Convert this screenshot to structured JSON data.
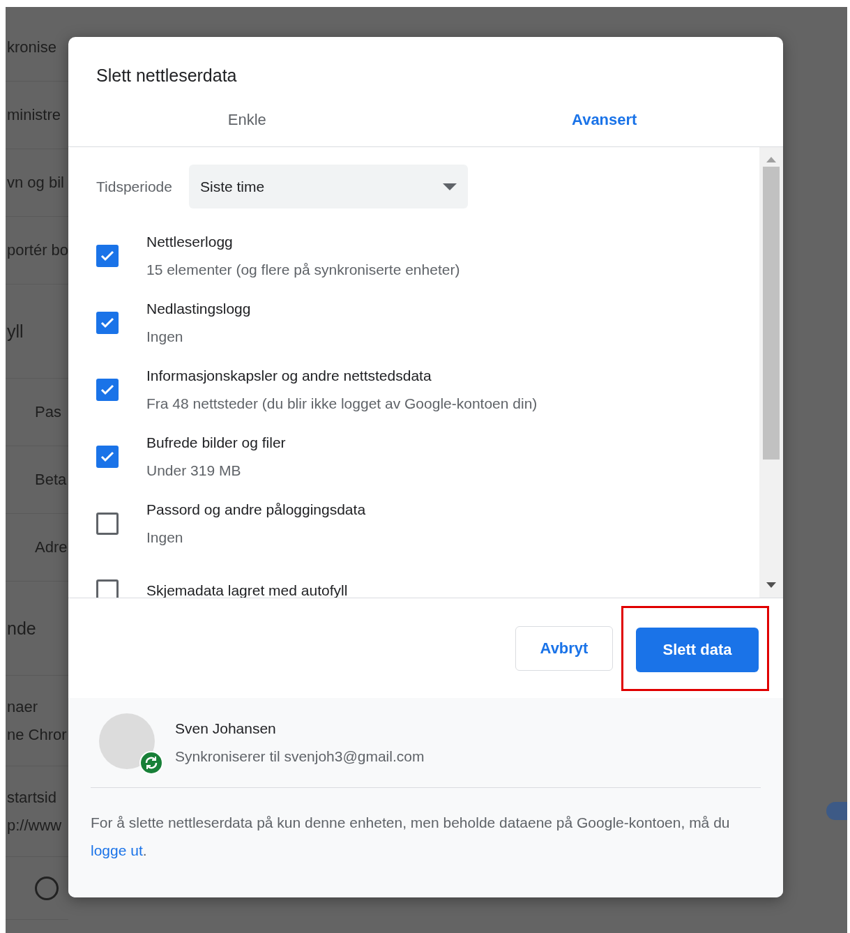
{
  "background": {
    "left_rows": [
      {
        "kind": "item",
        "lines": [
          "kronise"
        ]
      },
      {
        "kind": "item",
        "lines": [
          "ministre"
        ]
      },
      {
        "kind": "item",
        "lines": [
          "vn og bil"
        ]
      },
      {
        "kind": "item",
        "lines": [
          "portér bo"
        ]
      },
      {
        "kind": "heading",
        "lines": [
          "yll"
        ]
      },
      {
        "kind": "subitem",
        "lines": [
          "Pas"
        ]
      },
      {
        "kind": "subitem",
        "lines": [
          "Beta"
        ]
      },
      {
        "kind": "subitem",
        "lines": [
          "Adre"
        ]
      },
      {
        "kind": "heading",
        "lines": [
          "nde"
        ]
      },
      {
        "kind": "double",
        "lines": [
          "naer",
          "ne Chror"
        ]
      },
      {
        "kind": "double",
        "lines": [
          "startsid",
          "p://www"
        ]
      },
      {
        "kind": "radio",
        "selected": false
      }
    ],
    "toggle": {
      "on": true
    }
  },
  "dialog": {
    "title": "Slett nettleserdata",
    "tabs": [
      {
        "label": "Enkle",
        "selected": false
      },
      {
        "label": "Avansert",
        "selected": true
      }
    ],
    "time_range": {
      "label": "Tidsperiode",
      "value": "Siste time"
    },
    "options": [
      {
        "label": "Nettleserlogg",
        "detail": "15 elementer (og flere på synkroniserte enheter)",
        "checked": true
      },
      {
        "label": "Nedlastingslogg",
        "detail": "Ingen",
        "checked": true
      },
      {
        "label": "Informasjonskapsler og andre nettstedsdata",
        "detail": "Fra 48 nettsteder (du blir ikke logget av Google-kontoen din)",
        "checked": true
      },
      {
        "label": "Bufrede bilder og filer",
        "detail": "Under 319 MB",
        "checked": true
      },
      {
        "label": "Passord og andre påloggingsdata",
        "detail": "Ingen",
        "checked": false
      },
      {
        "label": "Skjemadata lagret med autofyll",
        "checked": false
      }
    ],
    "buttons": {
      "cancel": "Avbryt",
      "confirm": "Slett data"
    },
    "account": {
      "name": "Sven Johansen",
      "status": "Synkroniserer til svenjoh3@gmail.com"
    },
    "note": {
      "text": "For å slette nettleserdata på kun denne enheten, men beholde dataene på Google-kontoen, må du ",
      "link": "logge ut",
      "end": "."
    }
  }
}
